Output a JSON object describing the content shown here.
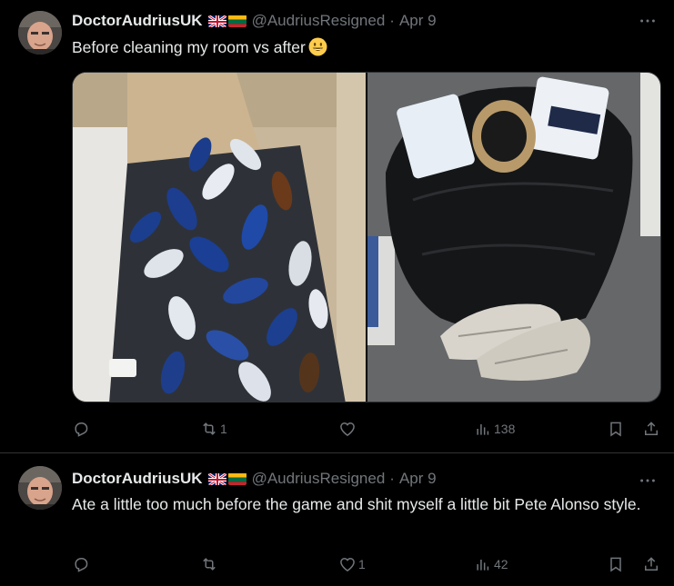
{
  "colors": {
    "background": "#000000",
    "text": "#e7e9ea",
    "muted": "#71767b",
    "divider": "#2f3336"
  },
  "tweets": [
    {
      "display_name": "DoctorAudriusUK",
      "flags": [
        "uk-flag-icon",
        "lithuania-flag-icon"
      ],
      "handle": "@AudriusResigned",
      "separator": "·",
      "date": "Apr 9",
      "text": "Before cleaning my room vs after",
      "emoji": "grinning-face-emoji",
      "media": [
        "photo-before-room-bottles",
        "photo-after-trash-bag-shoes"
      ],
      "actions": {
        "replies": "",
        "reposts": "1",
        "likes": "",
        "views": "138"
      }
    },
    {
      "display_name": "DoctorAudriusUK",
      "flags": [
        "uk-flag-icon",
        "lithuania-flag-icon"
      ],
      "handle": "@AudriusResigned",
      "separator": "·",
      "date": "Apr 9",
      "text": "Ate a little too much before the game and shit myself a little bit Pete Alonso style.",
      "actions": {
        "replies": "",
        "reposts": "",
        "likes": "1",
        "views": "42"
      }
    }
  ]
}
